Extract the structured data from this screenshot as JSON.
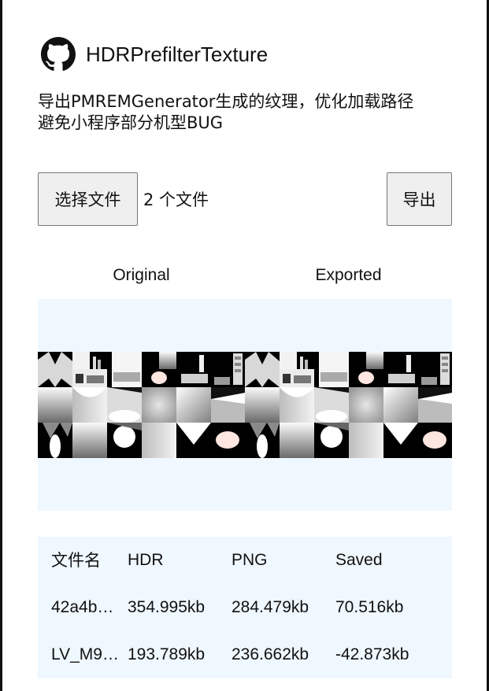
{
  "app": {
    "title": "HDRPrefilterTexture",
    "description_lines": [
      "导出PMREMGenerator生成的纹理，优化加载路径",
      "避免小程序部分机型BUG"
    ]
  },
  "controls": {
    "choose_files_label": "选择文件",
    "file_count_text": "2 个文件",
    "export_label": "导出"
  },
  "preview": {
    "original_label": "Original",
    "exported_label": "Exported"
  },
  "table": {
    "headers": [
      "文件名",
      "HDR",
      "PNG",
      "Saved"
    ],
    "rows": [
      [
        "42a4b…",
        "354.995kb",
        "284.479kb",
        "70.516kb"
      ],
      [
        "LV_M9…",
        "193.789kb",
        "236.662kb",
        "-42.873kb"
      ]
    ]
  },
  "colors": {
    "panel_background": "#eff7ff",
    "button_background": "#efefef"
  },
  "icons": {
    "brand": "github-icon"
  }
}
